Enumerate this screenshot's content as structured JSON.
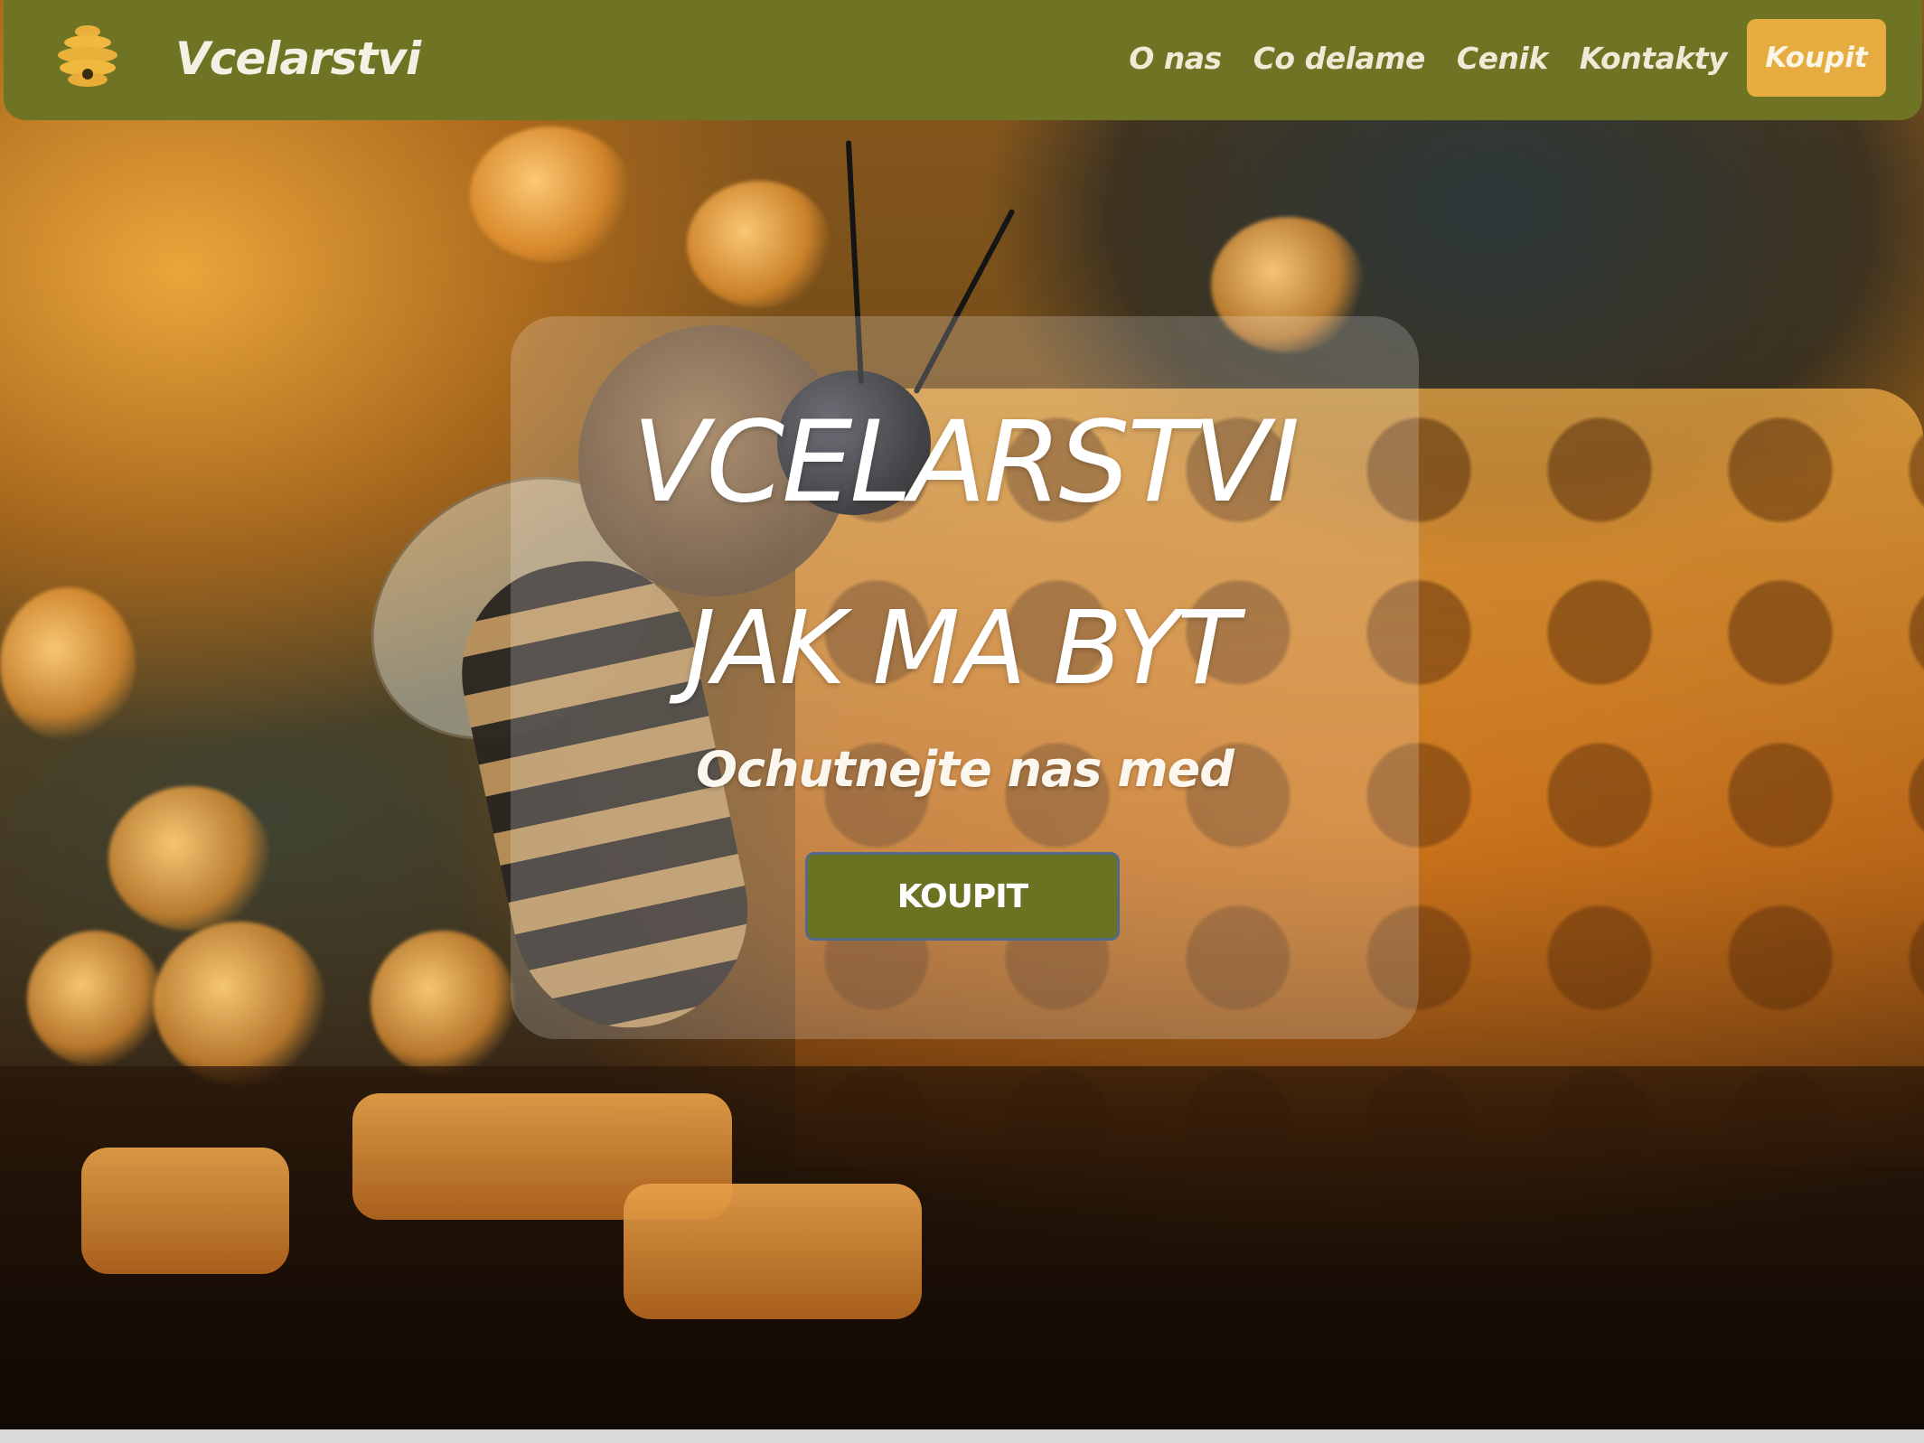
{
  "navbar": {
    "brand": "Vcelarstvi",
    "logo_icon": "beehive-icon",
    "links": [
      {
        "label": "O nas"
      },
      {
        "label": "Co delame"
      },
      {
        "label": "Cenik"
      },
      {
        "label": "Kontakty"
      }
    ],
    "buy_label": "Koupit",
    "colors": {
      "bar": "#6e7423",
      "buy_button": "#e7ac3f"
    }
  },
  "hero": {
    "title_line1": "VCELARSTVI",
    "title_line2": "JAK MA BYT",
    "subtitle": "Ochutnejte nas med",
    "button_label": "KOUPIT",
    "colors": {
      "button": "#6b7322"
    }
  }
}
